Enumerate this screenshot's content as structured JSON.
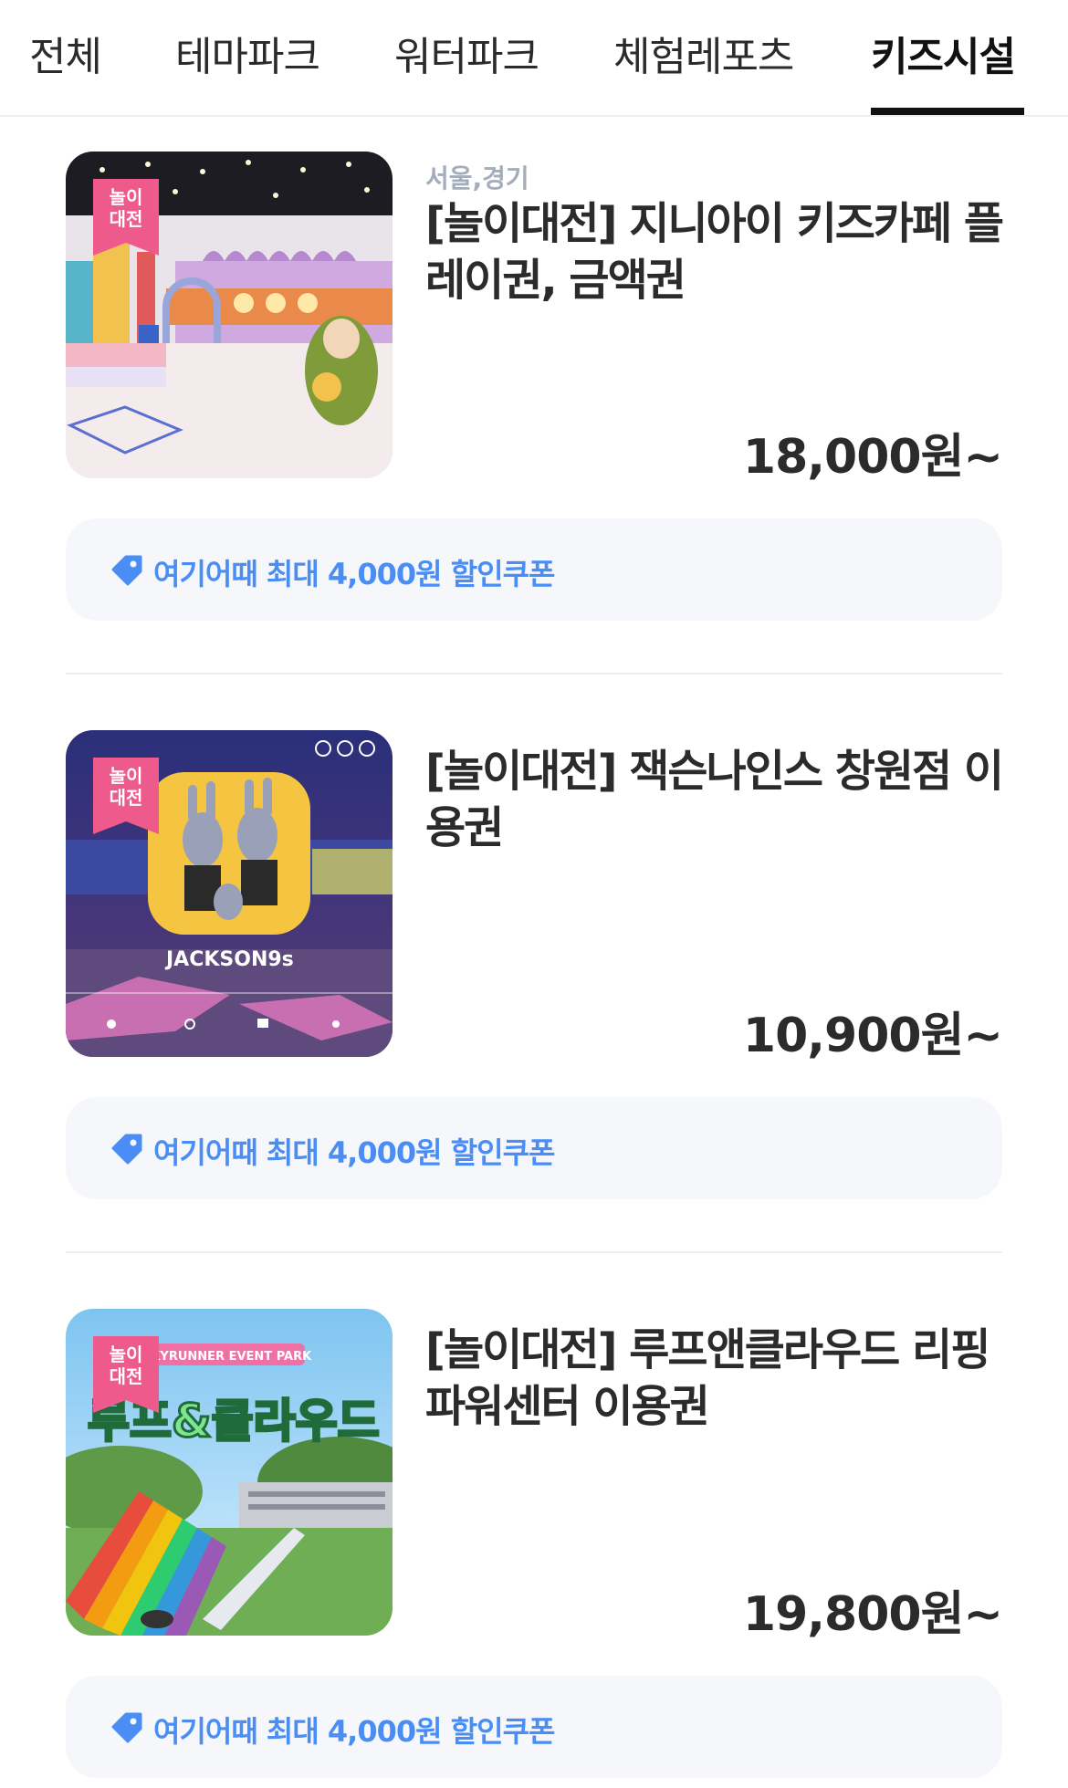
{
  "tabs": [
    {
      "label": "전체"
    },
    {
      "label": "테마파크"
    },
    {
      "label": "워터파크"
    },
    {
      "label": "체험레포츠"
    },
    {
      "label": "키즈시설",
      "active": true
    }
  ],
  "products": [
    {
      "badge": "놀이\n대전",
      "region": "서울,경기",
      "title": "[놀이대전] 지니아이 키즈카페 플레이권, 금액권",
      "price": "18,000원~",
      "coupon": "여기어때 최대 4,000원 할인쿠폰"
    },
    {
      "badge": "놀이\n대전",
      "title": "[놀이대전] 잭슨나인스 창원점 이용권",
      "price": "10,900원~",
      "coupon": "여기어때 최대 4,000원 할인쿠폰",
      "image_text": "JACKSON9s"
    },
    {
      "badge": "놀이\n대전",
      "title": "[놀이대전] 루프앤클라우드 리핑파워센터 이용권",
      "price": "19,800원~",
      "coupon": "여기어때 최대 4,000원 할인쿠폰",
      "image_text": "SKYRUNNER EVENT PARK",
      "image_logo": "루프&클라우드"
    }
  ],
  "colors": {
    "accent": "#4a8ef5",
    "badge": "#ef5a8c",
    "coupon_bg": "#f5f7fa"
  }
}
